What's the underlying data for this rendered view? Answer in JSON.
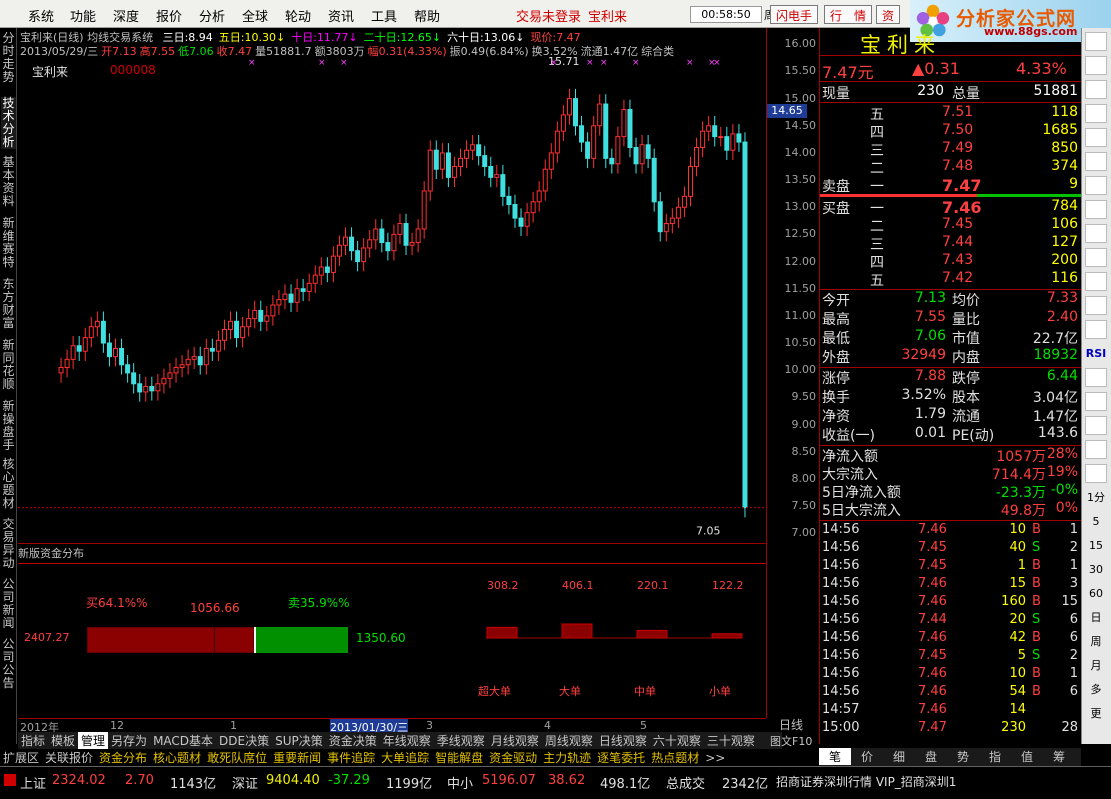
{
  "menu": {
    "items": [
      "系统",
      "功能",
      "深度",
      "报价",
      "分析",
      "全球",
      "轮动",
      "资讯",
      "工具",
      "帮助"
    ],
    "login": "交易未登录",
    "stock": "宝利来",
    "clock": "00:58:50",
    "week": "周四",
    "btn_flash": "闪电手",
    "btn_quote": "行　情",
    "btn_info": "资"
  },
  "logo": {
    "name": "分析家公式网",
    "url": "www.88gs.com"
  },
  "left_tabs": [
    "分时走势",
    "技术分析",
    "基本资料",
    "新维赛特",
    "东方财富",
    "新同花顺",
    "新操盘手",
    "核心题材",
    "交易异动",
    "公司新闻",
    "公司公告"
  ],
  "chart": {
    "info_title": "宝利来(日线) 均线交易系统",
    "ma": [
      {
        "label": "三日:8.94",
        "color": "#ffffff"
      },
      {
        "label": "五日:10.30↓",
        "color": "#ffff00"
      },
      {
        "label": "十日:11.77↓",
        "color": "#ff00ff"
      },
      {
        "label": "二十日:12.65↓",
        "color": "#00ff00"
      },
      {
        "label": "六十日:13.06↓",
        "color": "#ffffff"
      },
      {
        "label": "现价:7.47",
        "color": "#ff4040"
      }
    ],
    "info2": [
      {
        "t": "2013/05/29/三",
        "c": "#c0c0c0"
      },
      {
        "t": "开7.13",
        "c": "#ff4040"
      },
      {
        "t": "高7.55",
        "c": "#ff4040"
      },
      {
        "t": "低7.06",
        "c": "#00e000"
      },
      {
        "t": "收7.47",
        "c": "#ff4040"
      },
      {
        "t": "量51881.7",
        "c": "#c0c0c0"
      },
      {
        "t": "额3803万",
        "c": "#c0c0c0"
      },
      {
        "t": "幅0.31(4.33%)",
        "c": "#ff4040"
      },
      {
        "t": "振0.49(6.84%)",
        "c": "#c0c0c0"
      },
      {
        "t": "换3.52%",
        "c": "#c0c0c0"
      },
      {
        "t": "流通1.47亿",
        "c": "#c0c0c0"
      },
      {
        "t": "综合类",
        "c": "#c0c0c0"
      }
    ],
    "stock_name": "宝利来",
    "stock_code": "000008",
    "high_label": "15.71",
    "low_label": "7.05",
    "price_marker": "14.65",
    "yticks": [
      "16.00",
      "15.50",
      "15.00",
      "14.50",
      "14.00",
      "13.50",
      "13.00",
      "12.50",
      "12.00",
      "11.50",
      "11.00",
      "10.50",
      "10.00",
      "9.50",
      "9.00",
      "8.50",
      "8.00",
      "7.50",
      "7.00"
    ],
    "x_labels": [
      "2012年",
      "12",
      "1",
      "2013/01/30/三",
      "3",
      "4",
      "5"
    ],
    "period": "日线"
  },
  "chart_data": {
    "type": "candlestick",
    "title": "宝利来(日线)",
    "ylim": [
      6.8,
      16.3
    ],
    "last_close": 7.47,
    "closes": [
      10.05,
      10.2,
      10.45,
      10.35,
      10.6,
      10.8,
      10.9,
      10.5,
      10.25,
      10.4,
      10.1,
      9.95,
      9.75,
      9.6,
      9.7,
      9.62,
      9.75,
      9.85,
      9.95,
      10.05,
      10.1,
      10.2,
      10.25,
      10.1,
      10.4,
      10.35,
      10.55,
      10.75,
      10.9,
      10.6,
      10.8,
      10.95,
      11.1,
      10.9,
      11.0,
      11.2,
      11.3,
      11.4,
      11.25,
      11.5,
      11.45,
      11.6,
      11.75,
      11.9,
      11.8,
      12.1,
      12.3,
      12.45,
      12.2,
      12.0,
      12.25,
      12.4,
      12.6,
      12.35,
      12.2,
      12.5,
      12.7,
      12.3,
      12.35,
      12.6,
      13.3,
      14.05,
      13.7,
      14.0,
      13.55,
      13.75,
      13.9,
      14.05,
      14.15,
      13.95,
      13.75,
      13.55,
      13.6,
      13.2,
      13.05,
      12.8,
      12.65,
      12.9,
      13.1,
      13.3,
      13.7,
      14.0,
      14.4,
      14.7,
      15.0,
      14.5,
      14.2,
      13.9,
      14.5,
      14.9,
      13.9,
      13.8,
      14.3,
      14.8,
      14.1,
      13.8,
      14.15,
      13.9,
      13.1,
      12.55,
      12.7,
      12.8,
      13.0,
      13.2,
      13.75,
      14.1,
      14.4,
      14.5,
      14.3,
      14.3,
      14.05,
      14.35,
      14.2,
      7.47
    ],
    "volume_buckets": [
      {
        "name": "超大单",
        "value": 308.2
      },
      {
        "name": "大单",
        "value": 406.1
      },
      {
        "name": "中单",
        "value": 220.1
      },
      {
        "name": "小单",
        "value": 122.2
      }
    ]
  },
  "sub": {
    "title": "新版资金分布",
    "total": "2407.27",
    "buy_pct": "买64.1%%",
    "sell_pct": "卖35.9%%",
    "buy_val": "1056.66",
    "sell_val": "1350.60",
    "buy_frac": 0.641,
    "buy_inner_frac": 0.44
  },
  "right": {
    "name": "宝利来",
    "price": "7.47元",
    "change": "▲0.31",
    "pct": "4.33%",
    "vol_label": "现量",
    "vol": "230",
    "total_label": "总量",
    "total": "51881",
    "sells": [
      {
        "n": "五",
        "p": "7.51",
        "v": "118"
      },
      {
        "n": "四",
        "p": "7.50",
        "v": "1685"
      },
      {
        "n": "三",
        "p": "7.49",
        "v": "850"
      },
      {
        "n": "二",
        "p": "7.48",
        "v": "374"
      },
      {
        "n": "一",
        "p": "7.47",
        "v": "9"
      }
    ],
    "buys": [
      {
        "n": "一",
        "p": "7.46",
        "v": "784"
      },
      {
        "n": "二",
        "p": "7.45",
        "v": "106"
      },
      {
        "n": "三",
        "p": "7.44",
        "v": "127"
      },
      {
        "n": "四",
        "p": "7.43",
        "v": "200"
      },
      {
        "n": "五",
        "p": "7.42",
        "v": "116"
      }
    ],
    "sell_label": "卖盘",
    "buy_label": "买盘",
    "stats": [
      [
        "今开",
        "7.13",
        "#00e000",
        "均价",
        "7.33",
        "#ff4040"
      ],
      [
        "最高",
        "7.55",
        "#ff4040",
        "量比",
        "2.40",
        "#ff4040"
      ],
      [
        "最低",
        "7.06",
        "#00e000",
        "市值",
        "22.7亿",
        "#e0e0e0"
      ],
      [
        "外盘",
        "32949",
        "#ff4040",
        "内盘",
        "18932",
        "#00e000"
      ]
    ],
    "stats2": [
      [
        "涨停",
        "7.88",
        "#ff4040",
        "跌停",
        "6.44",
        "#00e000"
      ],
      [
        "换手",
        "3.52%",
        "#e0e0e0",
        "股本",
        "3.04亿",
        "#e0e0e0"
      ],
      [
        "净资",
        "1.79",
        "#e0e0e0",
        "流通",
        "1.47亿",
        "#e0e0e0"
      ],
      [
        "收益(一)",
        "0.01",
        "#e0e0e0",
        "PE(动)",
        "143.6",
        "#e0e0e0"
      ]
    ],
    "flow": [
      [
        "净流入额",
        "1057万",
        "28%"
      ],
      [
        "大宗流入",
        "714.4万",
        "19%"
      ],
      [
        "5日净流入额",
        "-23.3万",
        "-0%"
      ],
      [
        "5日大宗流入",
        "49.8万",
        "0%"
      ]
    ],
    "ticks": [
      [
        "14:56",
        "7.46",
        "10",
        "B",
        "1"
      ],
      [
        "14:56",
        "7.45",
        "40",
        "S",
        "2"
      ],
      [
        "14:56",
        "7.45",
        "1",
        "B",
        "1"
      ],
      [
        "14:56",
        "7.46",
        "15",
        "B",
        "3"
      ],
      [
        "14:56",
        "7.46",
        "160",
        "B",
        "15"
      ],
      [
        "14:56",
        "7.44",
        "20",
        "S",
        "6"
      ],
      [
        "14:56",
        "7.46",
        "42",
        "B",
        "6"
      ],
      [
        "14:56",
        "7.45",
        "5",
        "S",
        "2"
      ],
      [
        "14:56",
        "7.46",
        "10",
        "B",
        "1"
      ],
      [
        "14:56",
        "7.46",
        "54",
        "B",
        "6"
      ],
      [
        "14:57",
        "7.46",
        "14",
        "",
        ""
      ],
      [
        "15:00",
        "7.47",
        "230",
        "",
        "28"
      ]
    ]
  },
  "rightbar": [
    "",
    "",
    "",
    "",
    "",
    "",
    "",
    "",
    "",
    "",
    "",
    "",
    "",
    "RSI",
    "",
    "",
    "",
    "",
    "",
    "1分",
    "5",
    "15",
    "30",
    "60",
    "日",
    "周",
    "月",
    "多",
    "更"
  ],
  "tabs": [
    "指标",
    "模板",
    "管理",
    "另存为",
    "MACD基本",
    "DDE决策",
    "SUP决策",
    "资金决策",
    "年线观察",
    "季线观察",
    "月线观察",
    "周线观察",
    "日线观察",
    "六十观察",
    "三十观察"
  ],
  "tabs_active": "管理",
  "tab_f10": "图文F10",
  "tabs2": [
    "扩展区",
    "关联报价",
    "资金分布",
    "核心题材",
    "敢死队席位",
    "重要新闻",
    "事件追踪",
    "大单追踪",
    "智能解盘",
    "资金驱动",
    "主力轨迹",
    "逐笔委托",
    "热点题材",
    ">>"
  ],
  "rtabs": [
    "笔",
    "价",
    "细",
    "盘",
    "势",
    "指",
    "值",
    "筹"
  ],
  "status": {
    "sh_label": "上证",
    "sh": "2324.02",
    "sh_chg": "2.70",
    "sh_amt": "1143亿",
    "sz_label": "深证",
    "sz": "9404.40",
    "sz_chg": "-37.29",
    "sz_amt": "1199亿",
    "zx_label": "中小",
    "zx": "5196.07",
    "zx_chg": "38.62",
    "zx_amt": "498.1亿",
    "total_label": "总成交",
    "total": "2342亿",
    "broker": "招商证券深圳行情 VIP_招商深圳1"
  }
}
